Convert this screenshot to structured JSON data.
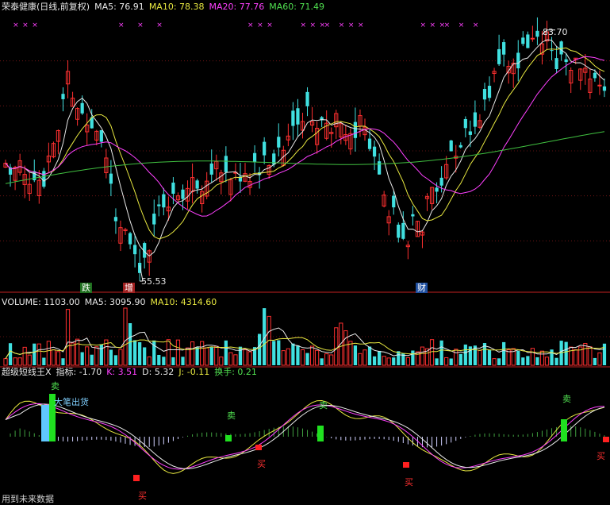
{
  "header": {
    "title": "荣泰健康(日线,前复权)",
    "ma5": "MA5: 76.91",
    "ma10": "MA10: 78.38",
    "ma20": "MA20: 77.76",
    "ma60": "MA60: 71.49"
  },
  "volume_header": {
    "volume": "VOLUME: 1103.00",
    "ma5": "MA5: 3095.90",
    "ma10": "MA10: 4314.60"
  },
  "indicator_header": {
    "name": "超级短线王X",
    "index": "指标: -1.70",
    "k": "K: 3.51",
    "d": "D: 5.32",
    "j": "J: -0.11",
    "turnover": "换手: 0.21"
  },
  "footer": "用到未来数据",
  "labels": {
    "high": "83.70",
    "low": "55.53",
    "die": "跌",
    "zeng": "增",
    "cai": "财",
    "signal_exit": "大笔出货",
    "sell": "卖",
    "buy": "买"
  },
  "colors": {
    "up": "#ff3030",
    "down": "#40e0e0",
    "ma5": "#e8e8e8",
    "ma10": "#e8e840",
    "ma20": "#ff40ff",
    "ma60": "#40c040",
    "sell_bar": "#20e020",
    "buy_bar": "#ff2020"
  },
  "chart_data": {
    "type": "candlestick",
    "series": [
      {
        "name": "MA5",
        "value": 76.91
      },
      {
        "name": "MA10",
        "value": 78.38
      },
      {
        "name": "MA20",
        "value": 77.76
      },
      {
        "name": "MA60",
        "value": 71.49
      }
    ],
    "annotations": {
      "high": 83.7,
      "low": 55.53
    },
    "volume": {
      "volume": 1103.0,
      "ma5": 3095.9,
      "ma10": 4314.6
    },
    "indicator": {
      "index": -1.7,
      "k": 3.51,
      "d": 5.32,
      "j": -0.11,
      "turnover": 0.21
    }
  }
}
